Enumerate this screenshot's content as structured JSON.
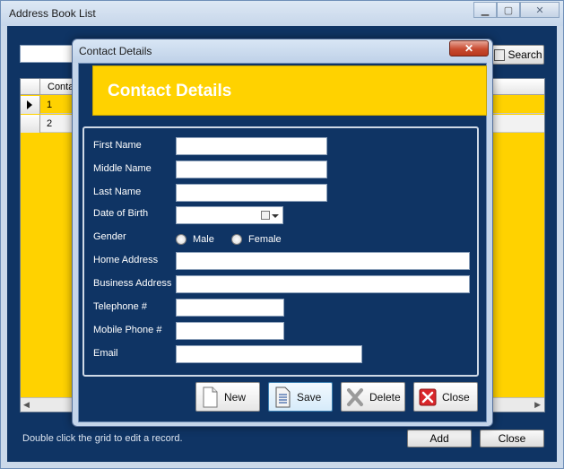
{
  "main_window": {
    "title": "Address Book List",
    "search_button": "Search",
    "grid": {
      "column_header": "Conta",
      "rows": [
        {
          "value": "1"
        },
        {
          "value": "2"
        }
      ]
    },
    "hint": "Double click the grid to edit a record.",
    "add_button": "Add",
    "close_button": "Close"
  },
  "dialog": {
    "title": "Contact Details",
    "banner": "Contact Details",
    "fields": {
      "first_name": {
        "label": "First Name",
        "value": ""
      },
      "middle_name": {
        "label": "Middle Name",
        "value": ""
      },
      "last_name": {
        "label": "Last Name",
        "value": ""
      },
      "date_of_birth": {
        "label": "Date of Birth",
        "value": ""
      },
      "gender": {
        "label": "Gender",
        "options": [
          "Male",
          "Female"
        ]
      },
      "home_address": {
        "label": "Home Address",
        "value": ""
      },
      "business_address": {
        "label": "Business Address",
        "value": ""
      },
      "telephone": {
        "label": "Telephone #",
        "value": ""
      },
      "mobile_phone": {
        "label": "Mobile Phone #",
        "value": ""
      },
      "email": {
        "label": "Email",
        "value": ""
      }
    },
    "buttons": {
      "new": "New",
      "save": "Save",
      "delete": "Delete",
      "close": "Close"
    }
  },
  "colors": {
    "client_bg": "#0f3464",
    "accent_yellow": "#ffd200",
    "window_frame": "#cbd9ea"
  }
}
